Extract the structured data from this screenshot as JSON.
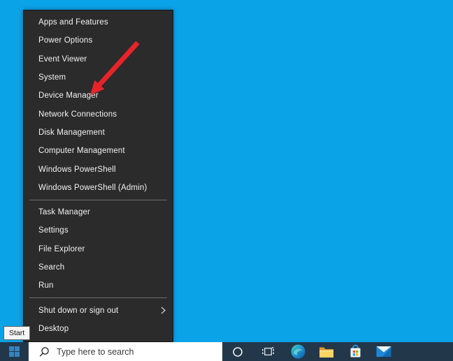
{
  "desktop": {
    "background_color": "#0ba3e8"
  },
  "context_menu": {
    "background_color": "#2b2b2b",
    "text_color": "#f2f2f2",
    "items": [
      {
        "label": "Apps and Features"
      },
      {
        "label": "Power Options"
      },
      {
        "label": "Event Viewer"
      },
      {
        "label": "System"
      },
      {
        "label": "Device Manager"
      },
      {
        "label": "Network Connections"
      },
      {
        "label": "Disk Management"
      },
      {
        "label": "Computer Management"
      },
      {
        "label": "Windows PowerShell"
      },
      {
        "label": "Windows PowerShell (Admin)"
      },
      {
        "label": "Task Manager"
      },
      {
        "label": "Settings"
      },
      {
        "label": "File Explorer"
      },
      {
        "label": "Search"
      },
      {
        "label": "Run"
      },
      {
        "label": "Shut down or sign out",
        "has_submenu": true
      },
      {
        "label": "Desktop"
      }
    ]
  },
  "arrow_annotation": {
    "color": "#e8232a",
    "points_to": "Device Manager"
  },
  "tooltip": {
    "label": "Start"
  },
  "taskbar": {
    "background_color": "#22384a",
    "search": {
      "placeholder": "Type here to search"
    },
    "icons": [
      {
        "name": "start-windows-logo"
      },
      {
        "name": "cortana-icon"
      },
      {
        "name": "task-view-icon"
      },
      {
        "name": "edge-icon"
      },
      {
        "name": "file-explorer-icon"
      },
      {
        "name": "store-icon"
      },
      {
        "name": "mail-icon"
      }
    ],
    "store_logo_colors": {
      "red": "#f25022",
      "green": "#7fba00",
      "blue": "#00a4ef",
      "yellow": "#ffb900"
    }
  }
}
